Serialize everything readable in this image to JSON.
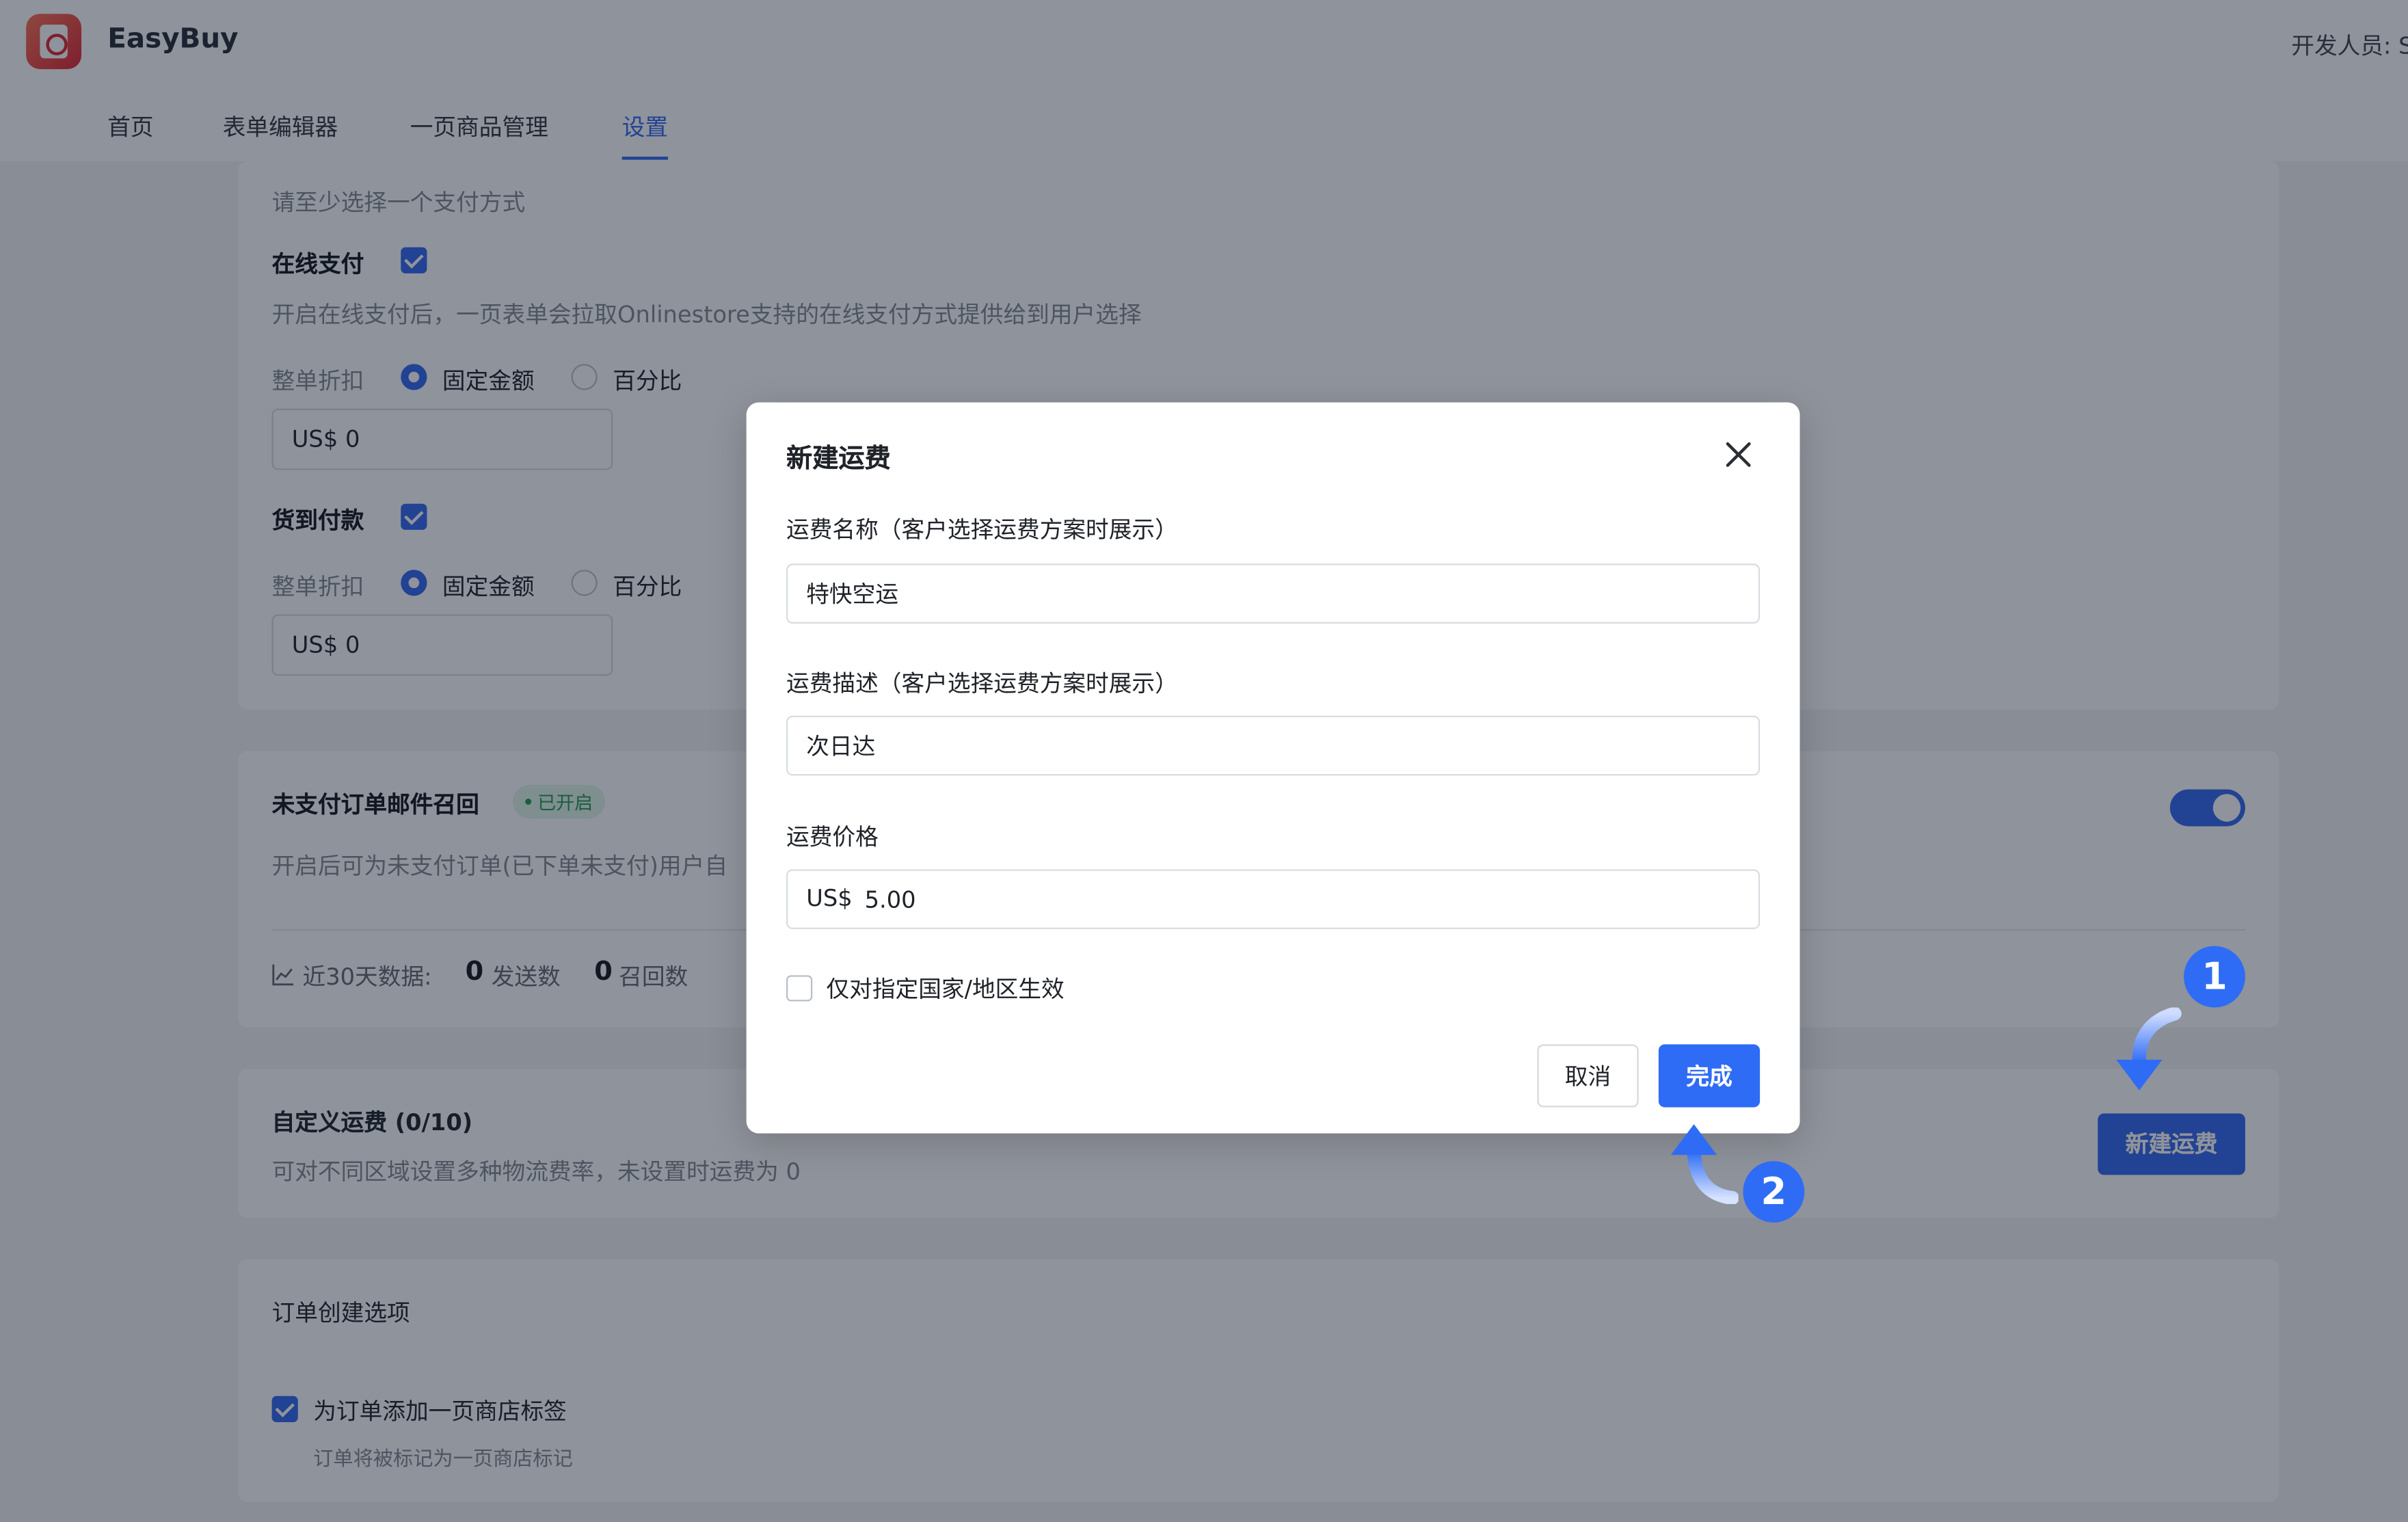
{
  "header": {
    "app_name": "EasyBuy",
    "developer_label": "开发人员: S"
  },
  "nav": {
    "tabs": [
      {
        "label": "首页"
      },
      {
        "label": "表单编辑器"
      },
      {
        "label": "一页商品管理"
      },
      {
        "label": "设置"
      }
    ],
    "active_tab": "设置"
  },
  "payment_card": {
    "hint": "请至少选择一个支付方式",
    "online_payment": {
      "label": "在线支付",
      "checked": true,
      "description": "开启在线支付后，一页表单会拉取Onlinestore支持的在线支付方式提供给到用户选择",
      "discount_label": "整单折扣",
      "option_fixed": "固定金额",
      "option_percent": "百分比",
      "amount": "US$  0"
    },
    "cod": {
      "label": "货到付款",
      "checked": true,
      "discount_label": "整单折扣",
      "option_fixed": "固定金额",
      "option_percent": "百分比",
      "amount": "US$  0"
    }
  },
  "recall_card": {
    "title": "未支付订单邮件召回",
    "status_badge": "已开启",
    "description": "开启后可为未支付订单(已下单未支付)用户自",
    "enabled": true,
    "stats_label": "近30天数据:",
    "sent_count": "0",
    "sent_label": "发送数",
    "recall_count": "0",
    "recall_label": "召回数"
  },
  "shipping_card": {
    "title": "自定义运费 (0/10)",
    "description": "可对不同区域设置多种物流费率，未设置时运费为 0",
    "new_button": "新建运费"
  },
  "order_card": {
    "title": "订单创建选项",
    "option_label": "为订单添加一页商店标签",
    "option_checked": true,
    "option_hint": "订单将被标记为一页商店标记"
  },
  "modal": {
    "title": "新建运费",
    "name_label": "运费名称（客户选择运费方案时展示）",
    "name_value": "特快空运",
    "desc_label": "运费描述（客户选择运费方案时展示）",
    "desc_value": "次日达",
    "price_label": "运费价格",
    "price_prefix": "US$",
    "price_value": "5.00",
    "region_only_label": "仅对指定国家/地区生效",
    "region_only_checked": false,
    "cancel_label": "取消",
    "done_label": "完成"
  },
  "annotations": {
    "step1": "1",
    "step2": "2",
    "accent_color": "#2f6cf5"
  }
}
